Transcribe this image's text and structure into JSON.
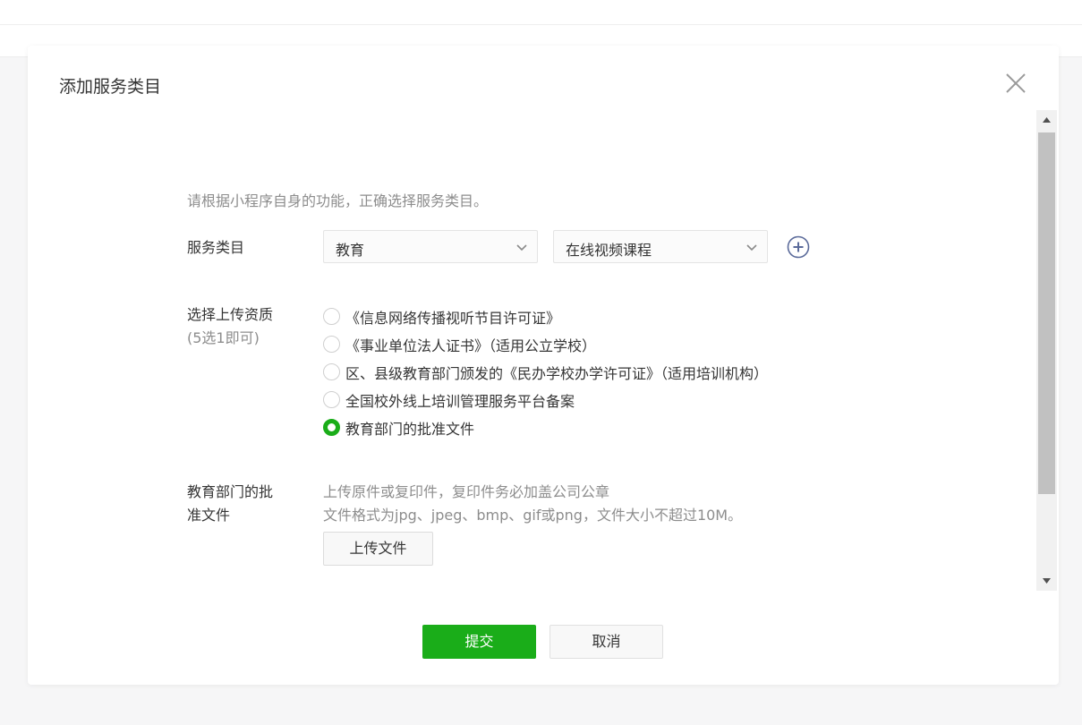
{
  "dialog": {
    "title": "添加服务类目"
  },
  "form": {
    "hint": "请根据小程序自身的功能，正确选择服务类目。",
    "category_label": "服务类目",
    "category_primary": "教育",
    "category_secondary": "在线视频课程",
    "qualification_label": "选择上传资质",
    "qualification_sublabel": "(5选1即可)",
    "qualifications": [
      {
        "label": "《信息网络传播视听节目许可证》",
        "checked": false
      },
      {
        "label": "《事业单位法人证书》（适用公立学校）",
        "checked": false
      },
      {
        "label": "区、县级教育部门颁发的《民办学校办学许可证》（适用培训机构）",
        "checked": false
      },
      {
        "label": "全国校外线上培训管理服务平台备案",
        "checked": false
      },
      {
        "label": "教育部门的批准文件",
        "checked": true
      }
    ],
    "upload_label_line1": "教育部门的批",
    "upload_label_line2": "准文件",
    "upload_desc_line1": "上传原件或复印件，复印件务必加盖公司公章",
    "upload_desc_line2": "文件格式为jpg、jpeg、bmp、gif或png，文件大小不超过10M。",
    "upload_button": "上传文件"
  },
  "footer": {
    "submit": "提交",
    "cancel": "取消"
  },
  "colors": {
    "accent": "#1aad19",
    "muted_text": "#8d8d8d",
    "plus_icon": "#5a6a9a"
  }
}
